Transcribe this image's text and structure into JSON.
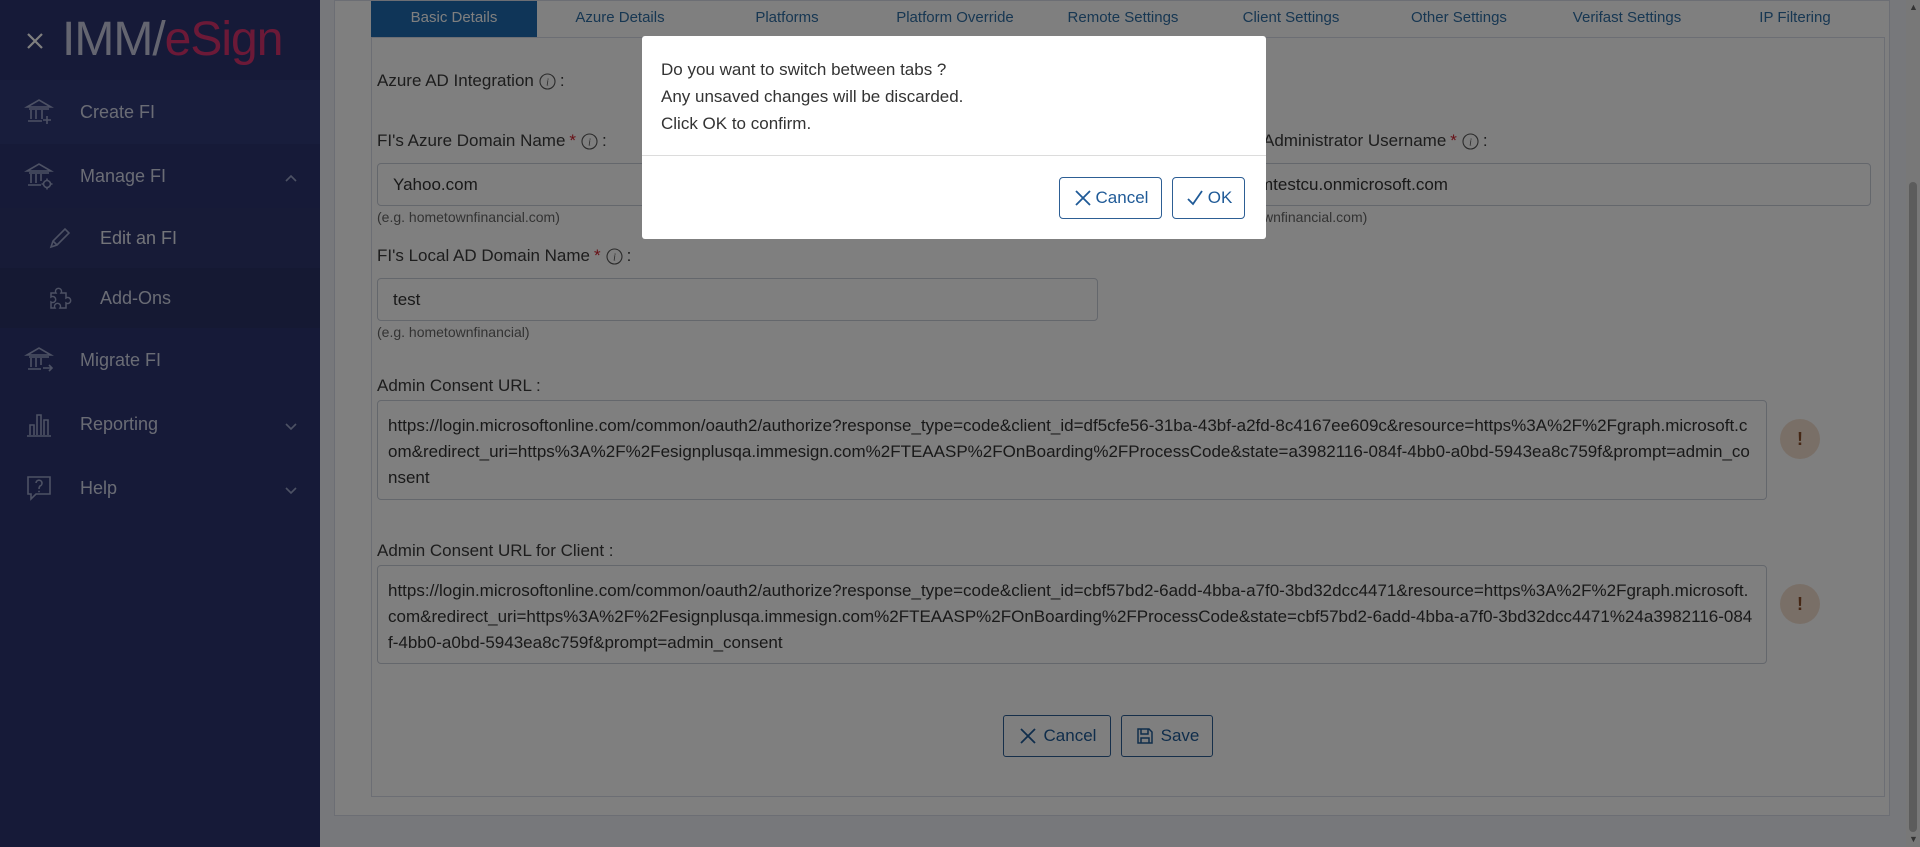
{
  "app": {
    "logo_imm": "IMM",
    "logo_esign": "eSign"
  },
  "sidebar": {
    "items": [
      {
        "label": "Create FI",
        "icon": "bank-plus-icon"
      },
      {
        "label": "Manage FI",
        "icon": "bank-gear-icon",
        "expanded": true
      },
      {
        "label": "Migrate FI",
        "icon": "bank-arrow-icon"
      },
      {
        "label": "Reporting",
        "icon": "bar-chart-icon"
      },
      {
        "label": "Help",
        "icon": "question-bubble-icon"
      }
    ],
    "sub_items": [
      {
        "label": "Edit an FI",
        "icon": "pencil-icon",
        "active": true
      },
      {
        "label": "Add-Ons",
        "icon": "puzzle-icon"
      }
    ]
  },
  "tabs": [
    {
      "label": "Basic Details",
      "active": true
    },
    {
      "label": "Azure Details"
    },
    {
      "label": "Platforms"
    },
    {
      "label": "Platform Override"
    },
    {
      "label": "Remote Settings"
    },
    {
      "label": "Client Settings"
    },
    {
      "label": "Other Settings"
    },
    {
      "label": "Verifast Settings"
    },
    {
      "label": "IP Filtering"
    }
  ],
  "form": {
    "azure_integration_label": "Azure AD Integration",
    "azure_integration_colon": ":",
    "azure_domain": {
      "label": "FI's Azure Domain Name",
      "value": "Yahoo.com",
      "hint": "(e.g. hometownfinancial.com)"
    },
    "admin_username": {
      "label": "Administrator Username",
      "value": "mtestcu.onmicrosoft.com",
      "hint": "wnfinancial.com)"
    },
    "local_domain": {
      "label": "FI's Local AD Domain Name",
      "value": "test",
      "hint": "(e.g. hometownfinancial)"
    },
    "admin_consent": {
      "label": "Admin Consent URL :",
      "value": "https://login.microsoftonline.com/common/oauth2/authorize?response_type=code&client_id=df5cfe56-31ba-43bf-a2fd-8c4167ee609c&resource=https%3A%2F%2Fgraph.microsoft.com&redirect_uri=https%3A%2F%2Fesignplusqa.immesign.com%2FTEAASP%2FOnBoarding%2FProcessCode&state=a3982116-084f-4bb0-a0bd-5943ea8c759f&prompt=admin_consent"
    },
    "admin_consent_client": {
      "label": "Admin Consent URL for Client :",
      "value": "https://login.microsoftonline.com/common/oauth2/authorize?response_type=code&client_id=cbf57bd2-6add-4bba-a7f0-3bd32dcc4471&resource=https%3A%2F%2Fgraph.microsoft.com&redirect_uri=https%3A%2F%2Fesignplusqa.immesign.com%2FTEAASP%2FOnBoarding%2FProcessCode&state=cbf57bd2-6add-4bba-a7f0-3bd32dcc4471%24a3982116-084f-4bb0-a0bd-5943ea8c759f&prompt=admin_consent"
    },
    "warn_symbol": "!",
    "required_mark": "*",
    "label_colon": ":",
    "cancel_label": "Cancel",
    "save_label": "Save"
  },
  "dialog": {
    "line1": "Do you want to switch between tabs ?",
    "line2": "Any unsaved changes will be discarded.",
    "line3": "Click OK to confirm.",
    "cancel_label": "Cancel",
    "ok_label": "OK"
  },
  "colors": {
    "sidebar_bg": "#2c3570",
    "active_tab": "#1f6bb0",
    "brand_pink": "#d8336f",
    "button_border": "#2d5e94",
    "required": "#d0202d"
  }
}
